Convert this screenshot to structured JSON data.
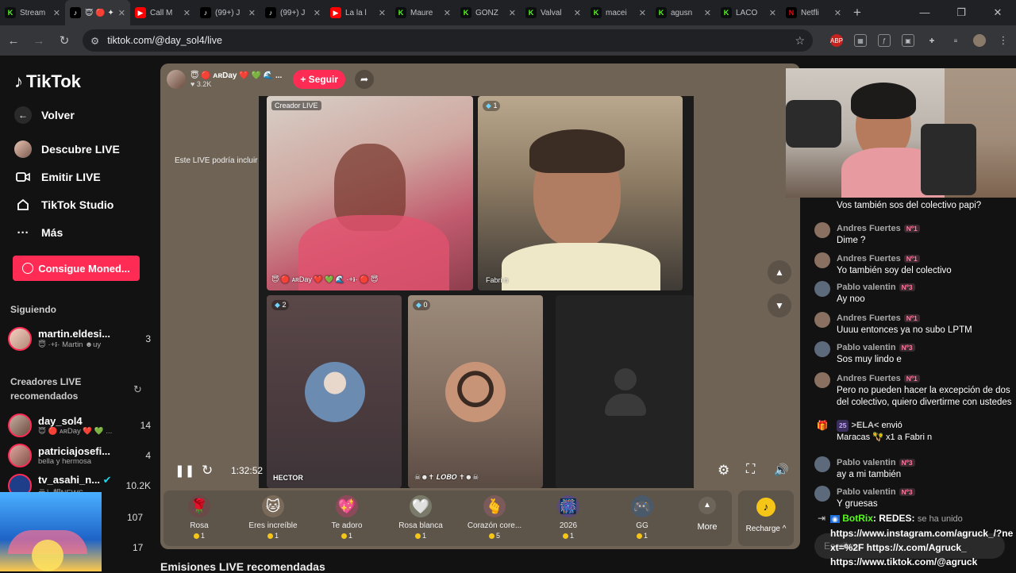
{
  "browser": {
    "tabs": [
      {
        "title": "Stream",
        "fav": "K",
        "color": "#53fc18",
        "bg": "#0b0e0f"
      },
      {
        "title": "😇 🔴 ✦",
        "fav": "♪",
        "color": "#ffffff",
        "bg": "#000000",
        "active": true
      },
      {
        "title": "Call M",
        "fav": "▶",
        "color": "#ffffff",
        "bg": "#ff0000"
      },
      {
        "title": "(99+) J",
        "fav": "♪",
        "color": "#ffffff",
        "bg": "#000000"
      },
      {
        "title": "(99+) J",
        "fav": "♪",
        "color": "#ffffff",
        "bg": "#000000"
      },
      {
        "title": "La la l",
        "fav": "▶",
        "color": "#ffffff",
        "bg": "#ff0000"
      },
      {
        "title": "Maure",
        "fav": "K",
        "color": "#53fc18",
        "bg": "#0b0e0f"
      },
      {
        "title": "GONZ",
        "fav": "K",
        "color": "#53fc18",
        "bg": "#0b0e0f"
      },
      {
        "title": "Valval",
        "fav": "K",
        "color": "#53fc18",
        "bg": "#0b0e0f"
      },
      {
        "title": "macei",
        "fav": "K",
        "color": "#53fc18",
        "bg": "#0b0e0f"
      },
      {
        "title": "agusn",
        "fav": "K",
        "color": "#53fc18",
        "bg": "#0b0e0f"
      },
      {
        "title": "LACO",
        "fav": "K",
        "color": "#53fc18",
        "bg": "#0b0e0f"
      },
      {
        "title": "Netfli",
        "fav": "N",
        "color": "#e50914",
        "bg": "#000000"
      }
    ],
    "url": "tiktok.com/@day_sol4/live"
  },
  "sidebar": {
    "logo": "TikTok",
    "items": [
      {
        "label": "Volver",
        "icon": "←"
      },
      {
        "label": "Descubre LIVE",
        "icon": "●"
      },
      {
        "label": "Emitir LIVE",
        "icon": "▭"
      },
      {
        "label": "TikTok Studio",
        "icon": "⌂"
      },
      {
        "label": "Más",
        "icon": "···"
      }
    ],
    "coins_button": "Consigue Moned...",
    "following_title": "Siguiendo",
    "following": [
      {
        "name": "martin.eldesi...",
        "sub": "😇 ·+៛· Martin ☻uy",
        "count": "3"
      }
    ],
    "recommended_title": "Creadores LIVE recomendados",
    "recommended": [
      {
        "name": "day_sol4",
        "sub": "😇 🔴 ᴀʀDay ❤️ 💚 ...",
        "count": "14"
      },
      {
        "name": "patriciajosefi...",
        "sub": "bella y hermosa",
        "count": "4"
      },
      {
        "name": "tv_asahi_n...",
        "sub": "テレ朝NEWS",
        "count": "10.2K"
      },
      {
        "name": "",
        "sub": "",
        "count": "107"
      },
      {
        "name": "",
        "sub": "",
        "count": "17"
      }
    ]
  },
  "live": {
    "host_name": "😇 🔴 ᴀʀDay ❤️ 💚 🌊 ...",
    "host_views": "3.2K",
    "follow_label": "+ Seguir",
    "ai_note": "Este LIVE podría incluir contenido generado por IA",
    "cells": {
      "creator_badge": "Creador LIVE",
      "creator_name": "😇 🔴 ᴀʀDay ❤️ 💚 🌊 ·+៛· 🔴 😇",
      "guest1_badge": "1",
      "guest1_name": "Fabri n",
      "guest2_badge": "2",
      "guest2_name": "HECTOR",
      "guest3_badge": "0",
      "guest3_name": "☠︎☻✝ 𝑳𝑶𝑩𝑶 ✝☻☠︎"
    },
    "timer": "1:32:52",
    "gifts": [
      {
        "name": "Rosa",
        "price": "1",
        "icon": "🌹"
      },
      {
        "name": "Eres increíble",
        "price": "1",
        "icon": "🐱"
      },
      {
        "name": "Te adoro",
        "price": "1",
        "icon": "💖"
      },
      {
        "name": "Rosa blanca",
        "price": "1",
        "icon": "🤍"
      },
      {
        "name": "Corazón core...",
        "price": "5",
        "icon": "🫰"
      },
      {
        "name": "2026",
        "price": "1",
        "icon": "🎆"
      },
      {
        "name": "GG",
        "price": "1",
        "icon": "🎮"
      }
    ],
    "more_label": "More",
    "recharge_label": "Recharge ^",
    "below_title": "Emisiones LIVE recomendadas"
  },
  "chat": {
    "messages": [
      {
        "user": "",
        "level": "",
        "text": "Vos también sos del colectivo papi?",
        "avatar": "#6f5a4e"
      },
      {
        "user": "Andres Fuertes",
        "level": "Nº1",
        "text": "Dime ?",
        "avatar": "#8a7060"
      },
      {
        "user": "Andres Fuertes",
        "level": "Nº1",
        "text": "Yo también soy del colectivo",
        "avatar": "#8a7060"
      },
      {
        "user": "Pablo valentin",
        "level": "Nº3",
        "text": "Ay noo",
        "avatar": "#5d6a7c"
      },
      {
        "user": "Andres Fuertes",
        "level": "Nº1",
        "text": "Uuuu entonces ya no subo LPTM",
        "avatar": "#8a7060"
      },
      {
        "user": "Pablo valentin",
        "level": "Nº3",
        "text": "Sos muy lindo e",
        "avatar": "#5d6a7c"
      },
      {
        "user": "Andres Fuertes",
        "level": "Nº1",
        "text": "Pero no pueden hacer la excepción de dos del colectivo, quiero divertirme con ustedes",
        "avatar": "#8a7060"
      }
    ],
    "gift_event": {
      "level": "25",
      "user": ">ELA<",
      "action": "envió",
      "detail": "Maracas 🪇 x1 a Fabri n"
    },
    "messages2": [
      {
        "user": "Pablo valentin",
        "level": "Nº3",
        "text": "ay a mi también",
        "avatar": "#5d6a7c"
      },
      {
        "user": "Pablo valentin",
        "level": "Nº3",
        "text": "Y gruesas",
        "avatar": "#5d6a7c"
      }
    ],
    "joined_text": "se ha unido",
    "bot_overlay": {
      "name": "BotRix",
      "text": ": REDES:",
      "line1": "https://www.instagram.com/agruck_/?next=%2F https://x.com/Agruck_",
      "line2": "https://www.tiktok.com/@agruck"
    },
    "input_placeholder": "Escribe..."
  }
}
